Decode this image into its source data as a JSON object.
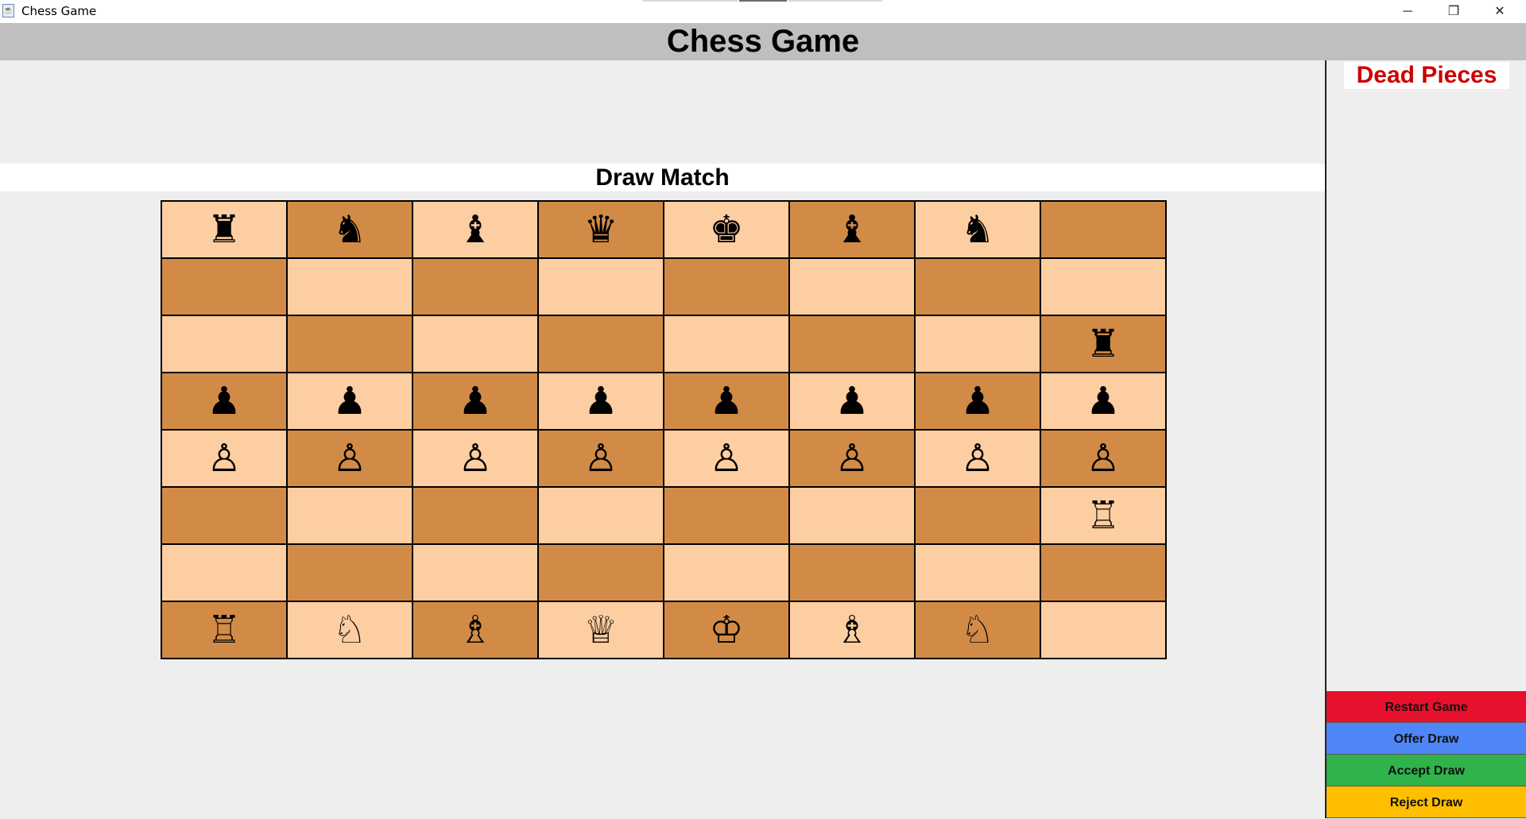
{
  "window": {
    "title": "Chess Game",
    "minimize_glyph": "─",
    "restore_glyph": "❐",
    "close_glyph": "✕",
    "icon": "java-cup-icon"
  },
  "header": {
    "title": "Chess Game"
  },
  "status": {
    "text": "Draw Match"
  },
  "board": {
    "light_color": "#fdcea1",
    "dark_color": "#d18b47",
    "squares": [
      [
        "♜",
        "♞",
        "♝",
        "♛",
        "♚",
        "♝",
        "♞",
        ""
      ],
      [
        "",
        "",
        "",
        "",
        "",
        "",
        "",
        ""
      ],
      [
        "",
        "",
        "",
        "",
        "",
        "",
        "",
        "♜"
      ],
      [
        "♟",
        "♟",
        "♟",
        "♟",
        "♟",
        "♟",
        "♟",
        "♟"
      ],
      [
        "♙",
        "♙",
        "♙",
        "♙",
        "♙",
        "♙",
        "♙",
        "♙"
      ],
      [
        "",
        "",
        "",
        "",
        "",
        "",
        "",
        "♖"
      ],
      [
        "",
        "",
        "",
        "",
        "",
        "",
        "",
        ""
      ],
      [
        "♖",
        "♘",
        "♗",
        "♕",
        "♔",
        "♗",
        "♘",
        ""
      ]
    ]
  },
  "side_panel": {
    "dead_pieces_title": "Dead Pieces",
    "dead_pieces": [],
    "buttons": {
      "restart": {
        "label": "Restart Game",
        "color": "#e8112d"
      },
      "offer": {
        "label": "Offer Draw",
        "color": "#4f86f7"
      },
      "accept": {
        "label": "Accept Draw",
        "color": "#2fb34a"
      },
      "reject": {
        "label": "Reject Draw",
        "color": "#ffbf00"
      }
    }
  }
}
